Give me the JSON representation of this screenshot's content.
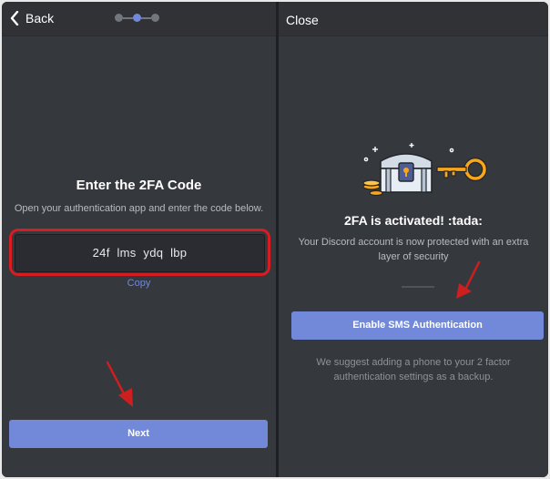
{
  "left_panel": {
    "back_label": "Back",
    "title": "Enter the 2FA Code",
    "subtitle": "Open your authentication app and enter the code below.",
    "code": "24f  lms  ydq  lbp",
    "copy_label": "Copy",
    "next_label": "Next",
    "step_indicator": {
      "total": 3,
      "current": 2
    }
  },
  "right_panel": {
    "close_label": "Close",
    "title": "2FA is activated! :tada:",
    "message_line1": "Your Discord account is now protected with an extra",
    "message_line2": "layer of security",
    "sms_button_label": "Enable SMS Authentication",
    "hint_line1": "We suggest adding a phone to your 2 factor",
    "hint_line2": "authentication settings as a backup."
  },
  "icons": {
    "back": "chevron-left-icon",
    "treasure": "treasure-chest-icon",
    "key": "key-icon",
    "annotation": "red-arrow"
  },
  "colors": {
    "accent": "#7289da",
    "background": "#35383d",
    "highlight": "#d71c22",
    "arrow": "#cc1f1f"
  }
}
